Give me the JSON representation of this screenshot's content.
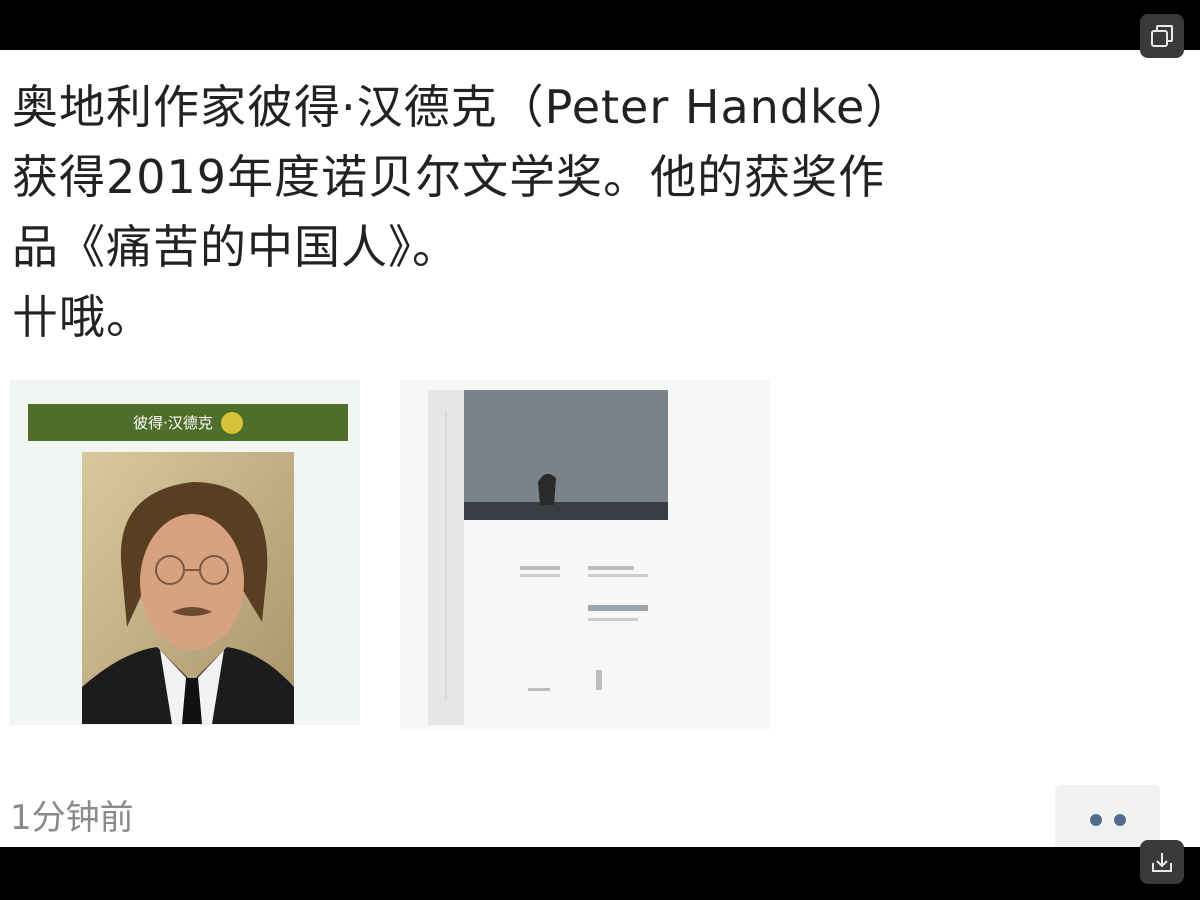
{
  "post": {
    "lines": [
      "奥地利作家彼得·汉德克（Peter Handke）",
      "获得2019年度诺贝尔文学奖。他的获奖作",
      "品《痛苦的中国人》。",
      "卄哦。"
    ],
    "timestamp": "1分钟前"
  },
  "photo_card": {
    "header": "彼得·汉德克"
  },
  "book": {
    "title": "痛苦的中国人"
  },
  "colors": {
    "header_green": "#4e6e2c",
    "timestamp_gray": "#8a8a8a",
    "dots_blue": "#536b8c"
  },
  "icons": {
    "top_corner": "window-restore-icon",
    "bottom_corner": "download-icon"
  }
}
